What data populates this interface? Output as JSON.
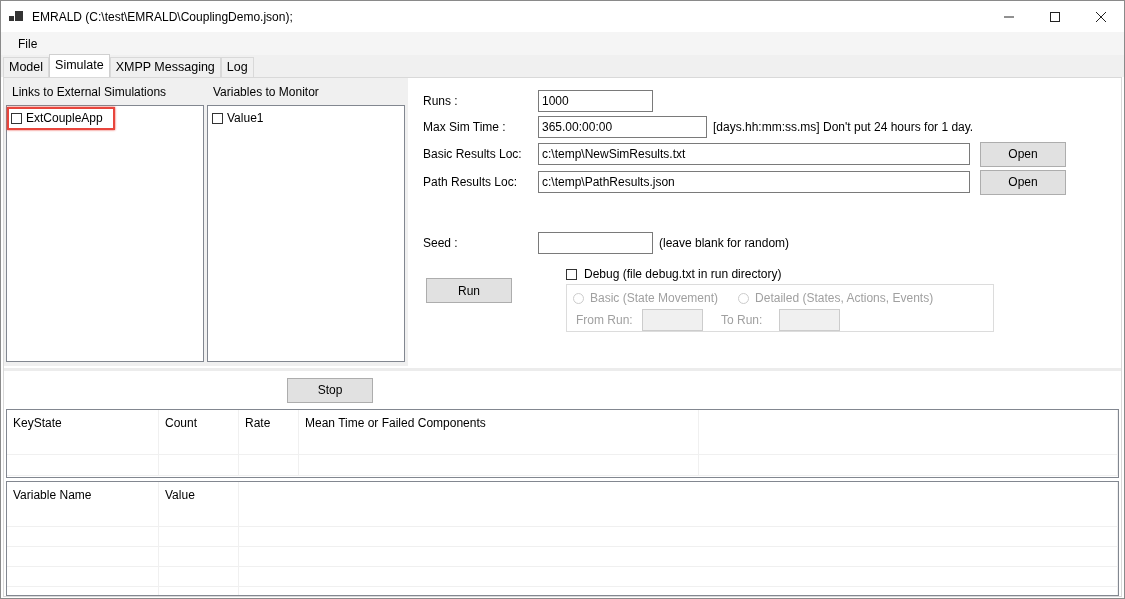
{
  "window": {
    "title": "EMRALD (C:\\test\\EMRALD\\CouplingDemo.json);"
  },
  "menu": [
    "File"
  ],
  "tabs": [
    {
      "label": "Model",
      "selected": false
    },
    {
      "label": "Simulate",
      "selected": true
    },
    {
      "label": "XMPP Messaging",
      "selected": false
    },
    {
      "label": "Log",
      "selected": false
    }
  ],
  "lists": [
    {
      "header": "Links to External Simulations",
      "items": [
        {
          "label": "ExtCoupleApp",
          "checked": false,
          "highlighted": true
        }
      ]
    },
    {
      "header": "Variables to Monitor",
      "items": [
        {
          "label": "Value1",
          "checked": false,
          "highlighted": false
        }
      ]
    }
  ],
  "form": {
    "runs": {
      "label": "Runs :",
      "value": "1000"
    },
    "max_sim_time": {
      "label": "Max Sim Time :",
      "value": "365.00:00:00",
      "hint": "[days.hh:mm:ss.ms]  Don't put 24 hours for 1 day."
    },
    "basic_results": {
      "label": "Basic Results Loc:",
      "value": "c:\\temp\\NewSimResults.txt",
      "button": "Open"
    },
    "path_results": {
      "label": "Path Results Loc:",
      "value": "c:\\temp\\PathResults.json",
      "button": "Open"
    },
    "seed": {
      "label": "Seed :",
      "hint": "(leave blank for random)"
    },
    "run_button": "Run",
    "debug": {
      "label": "Debug (file debug.txt in run directory)",
      "checked": false,
      "disabled": true,
      "options": [
        {
          "label": "Basic (State Movement)",
          "selected": false
        },
        {
          "label": "Detailed (States, Actions, Events)",
          "selected": false
        }
      ],
      "from_run": {
        "label": "From Run:"
      },
      "to_run": {
        "label": "To Run:"
      }
    }
  },
  "stop_button": "Stop",
  "results_table": {
    "columns": [
      "KeyState",
      "Count",
      "Rate",
      "Mean Time or Failed Components"
    ]
  },
  "variables_table": {
    "columns": [
      "Variable Name",
      "Value"
    ]
  }
}
